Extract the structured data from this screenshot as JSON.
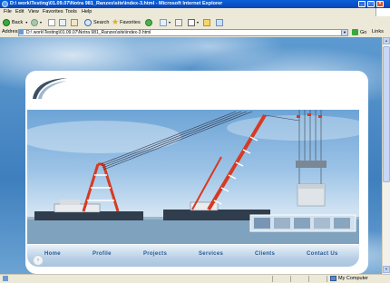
{
  "window": {
    "title": "D:\\ work\\Testing\\01.09.07\\Notra 981_Ranzes\\site\\index-3.html - Microsoft Internet Explorer"
  },
  "menu": [
    "File",
    "Edit",
    "View",
    "Favorites",
    "Tools",
    "Help"
  ],
  "toolbar": {
    "back_label": "Back",
    "search_label": "Search",
    "favorites_label": "Favorites"
  },
  "address": {
    "label": "Address",
    "url": "D:\\ work\\Testing\\01.09.07\\Notra 981_Ranzes\\site\\index-3.html",
    "go_label": "Go",
    "links_label": "Links"
  },
  "site": {
    "nav": [
      "Home",
      "Profile",
      "Projects",
      "Services",
      "Clients",
      "Contact Us"
    ],
    "circle_button_glyph": "›"
  },
  "status": {
    "left_text": "",
    "zone_label": "My Computer"
  },
  "colors": {
    "nav_text": "#2d5a8e",
    "crane_red": "#d63a22",
    "titlebar": "#0a5fd8"
  }
}
